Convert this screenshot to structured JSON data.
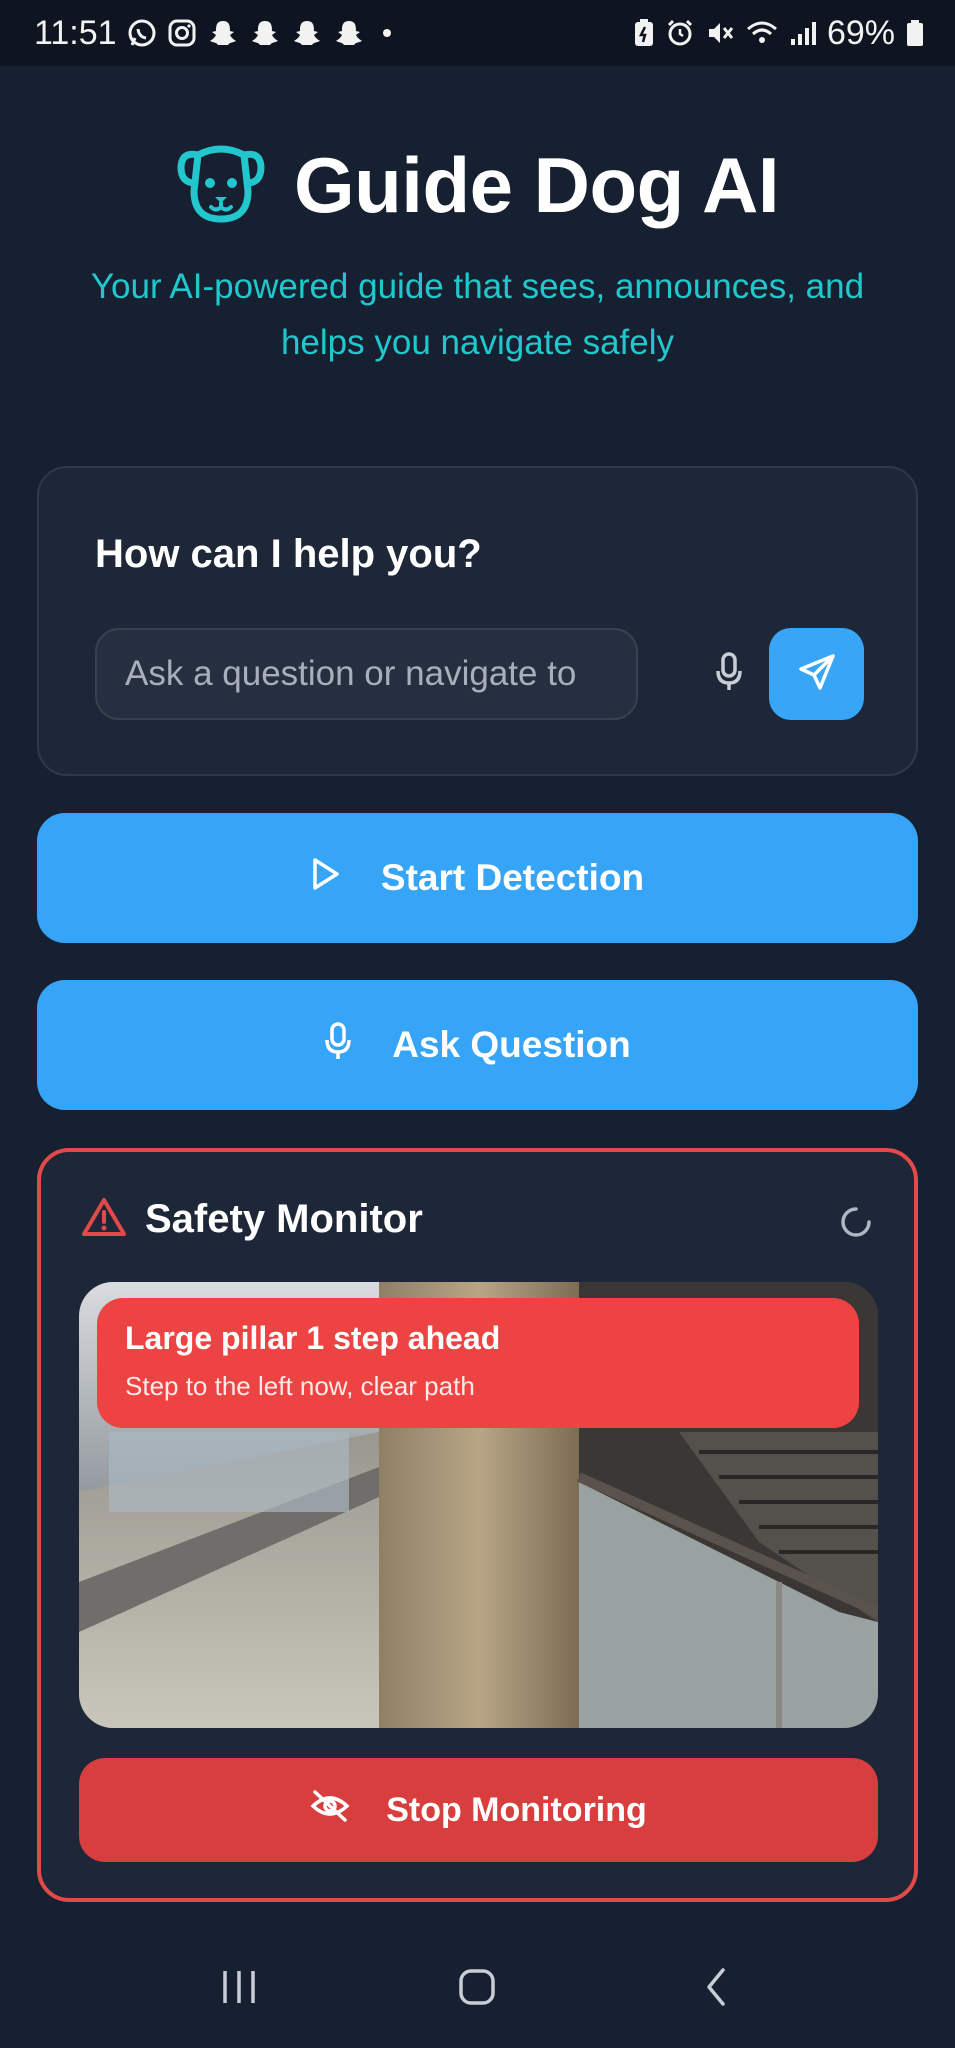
{
  "status_bar": {
    "time": "11:51",
    "battery": "69%",
    "left_icons": [
      "whatsapp-icon",
      "instagram-icon",
      "snapchat-icon",
      "snapchat-icon",
      "snapchat-icon",
      "snapchat-icon"
    ],
    "right_icons": [
      "battery-saver-icon",
      "alarm-icon",
      "mute-icon",
      "wifi-icon",
      "signal-icon",
      "battery-icon"
    ]
  },
  "header": {
    "logo_icon": "dog-face-icon",
    "title": "Guide Dog AI",
    "subtitle": "Your AI-powered guide that sees, announces, and helps you navigate safely"
  },
  "help": {
    "title": "How can I help you?",
    "input_placeholder": "Ask a question or navigate to",
    "input_value": ""
  },
  "actions": {
    "start_detection": "Start Detection",
    "ask_question": "Ask Question"
  },
  "safety": {
    "title": "Safety Monitor",
    "alert_title": "Large pillar 1 step ahead",
    "alert_subtitle": "Step to the left now, clear path",
    "stop_label": "Stop Monitoring"
  },
  "colors": {
    "background": "#162031",
    "accent_blue": "#36a4f7",
    "accent_teal": "#21c7cc",
    "danger_red": "#ee4343"
  }
}
